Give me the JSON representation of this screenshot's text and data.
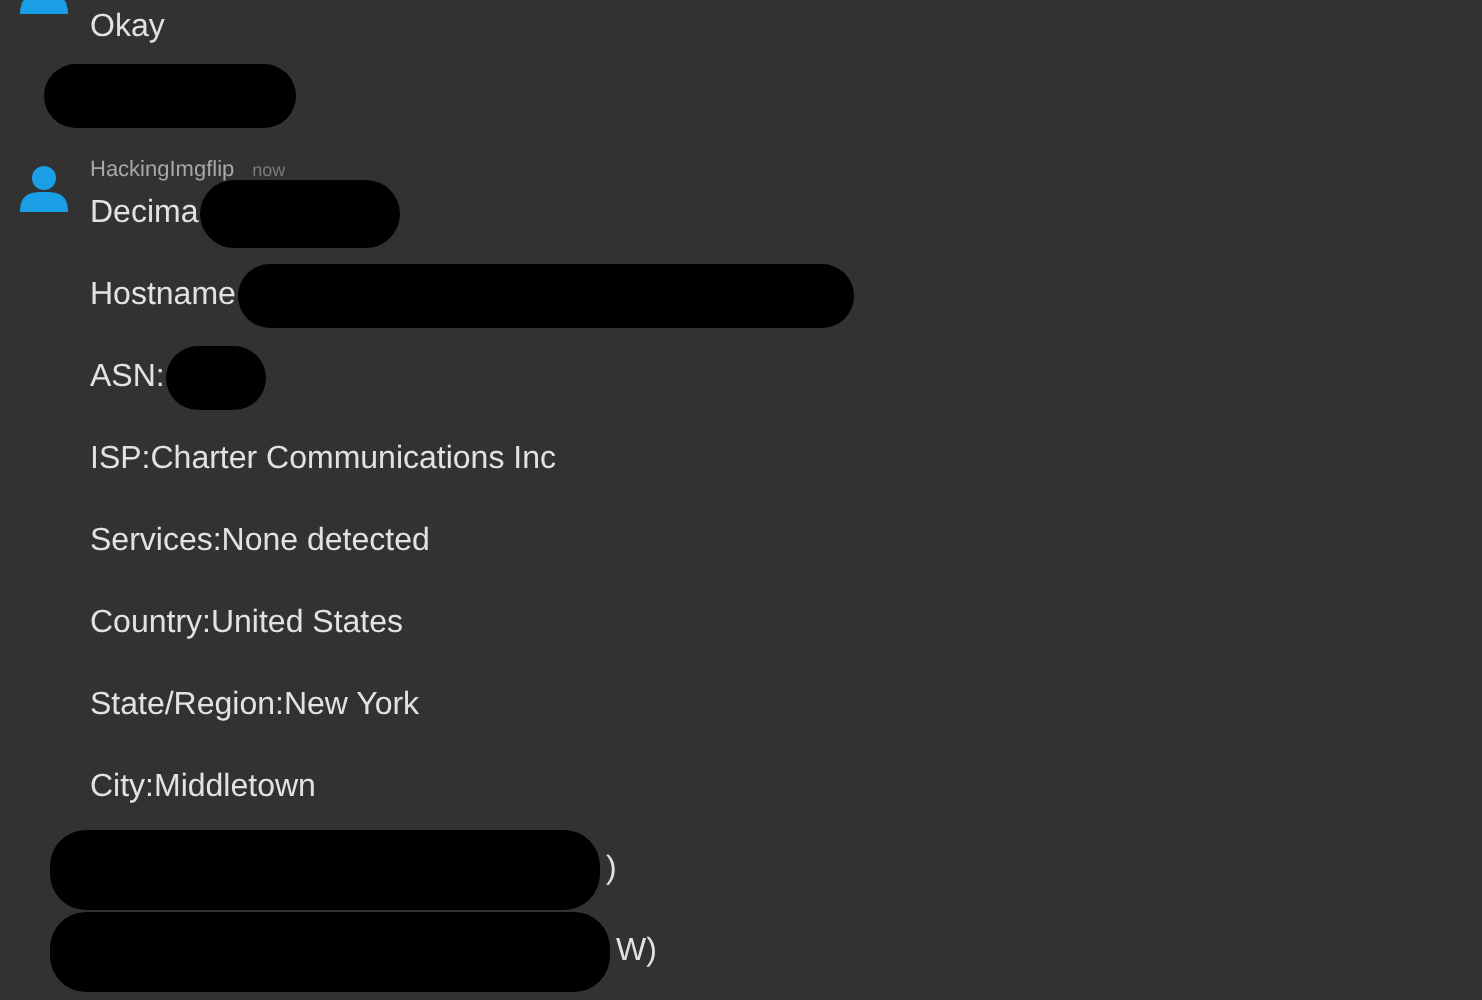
{
  "messages": [
    {
      "lines": [
        [
          {
            "kind": "text",
            "text": "Okay"
          }
        ],
        [
          {
            "kind": "redaction"
          }
        ]
      ]
    },
    {
      "author": "HackingImgflip",
      "time": "now",
      "lines": [
        [
          {
            "kind": "text",
            "text": "Decima"
          },
          {
            "kind": "redaction"
          }
        ],
        [
          {
            "kind": "text",
            "text": "Hostname"
          },
          {
            "kind": "redaction"
          }
        ],
        [
          {
            "kind": "text",
            "text": "ASN:"
          },
          {
            "kind": "redaction"
          }
        ],
        [
          {
            "kind": "text",
            "text": "ISP:Charter Communications Inc"
          }
        ],
        [
          {
            "kind": "text",
            "text": "Services:None detected"
          }
        ],
        [
          {
            "kind": "text",
            "text": "Country:United States"
          }
        ],
        [
          {
            "kind": "text",
            "text": "State/Region:New York"
          }
        ],
        [
          {
            "kind": "text",
            "text": "City:Middletown"
          }
        ],
        [
          {
            "kind": "redaction"
          },
          {
            "kind": "text",
            "text": ")"
          }
        ],
        [
          {
            "kind": "redaction"
          },
          {
            "kind": "text",
            "text": "W)"
          }
        ]
      ]
    }
  ]
}
